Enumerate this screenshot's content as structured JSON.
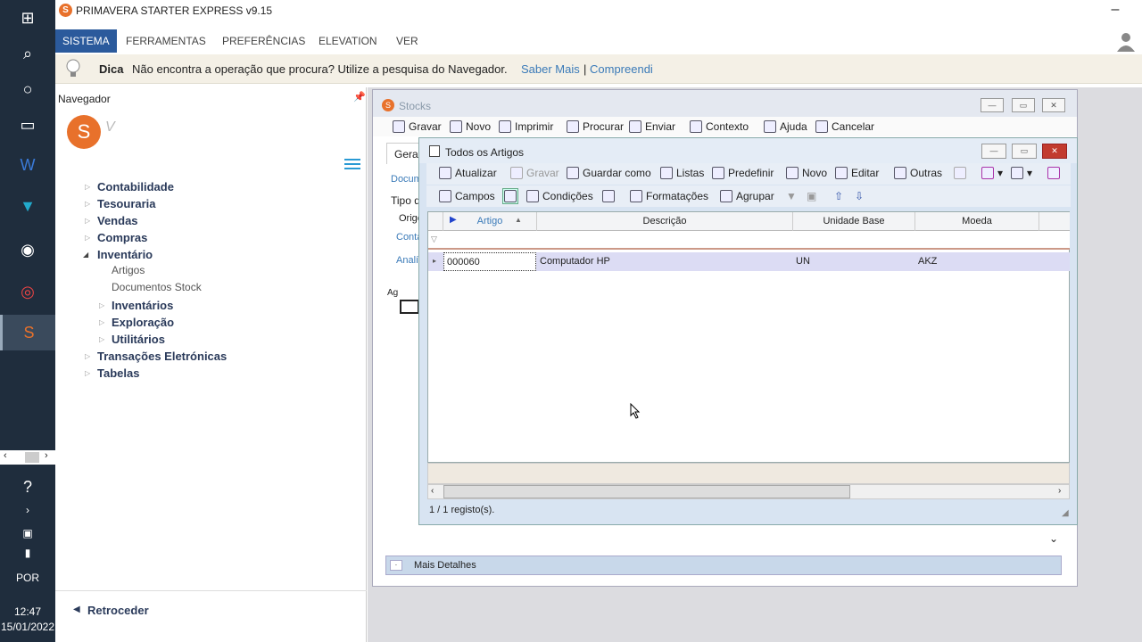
{
  "taskbar": {
    "language": "POR",
    "time": "12:47",
    "date": "15/01/2022"
  },
  "app": {
    "title": "PRIMAVERA STARTER EXPRESS v9.15",
    "logo_letter": "S"
  },
  "menu": {
    "items": [
      "SISTEMA",
      "FERRAMENTAS",
      "PREFERÊNCIAS",
      "ELEVATION",
      "VER"
    ]
  },
  "tip": {
    "label": "Dica",
    "text": "Não encontra a operação que procura? Utilize a pesquisa do Navegador.",
    "link1": "Saber Mais",
    "separator": "|",
    "link2": "Compreendi"
  },
  "navigator": {
    "header": "Navegador",
    "items": [
      "Contabilidade",
      "Tesouraria",
      "Vendas",
      "Compras",
      "Inventário"
    ],
    "inventario_children": [
      "Artigos",
      "Documentos Stock"
    ],
    "inventario_groups": [
      "Inventários",
      "Exploração",
      "Utilitários"
    ],
    "items_after": [
      "Transações Eletrónicas",
      "Tabelas"
    ],
    "back": "Retroceder"
  },
  "stocks": {
    "title": "Stocks",
    "toolbar": [
      "Gravar",
      "Novo",
      "Imprimir",
      "Procurar",
      "Enviar",
      "Contexto",
      "Ajuda",
      "Cancelar"
    ],
    "tab": "Geral",
    "labels": [
      "Docum",
      "Tipo do",
      "Orige",
      "Conta",
      "Analí",
      "Ag"
    ],
    "more_details": "Mais Detalhes"
  },
  "artigos": {
    "title": "Todos os Artigos",
    "toolbar1": [
      "Atualizar",
      "Gravar",
      "Guardar como",
      "Listas",
      "Predefinir",
      "Novo",
      "Editar",
      "Outras"
    ],
    "toolbar2": [
      "Campos",
      "Condições",
      "Formatações",
      "Agrupar"
    ],
    "columns": [
      "Artigo",
      "Descrição",
      "Unidade Base",
      "Moeda"
    ],
    "rows": [
      {
        "artigo": "000060",
        "descricao": "Computador HP",
        "unidade": "UN",
        "moeda": "AKZ"
      }
    ],
    "status": "1 / 1 registo(s)."
  },
  "colors": {
    "accent": "#2b5a9c",
    "brand": "#e8712b",
    "link": "#3a7ab8",
    "close": "#c23b2f"
  }
}
